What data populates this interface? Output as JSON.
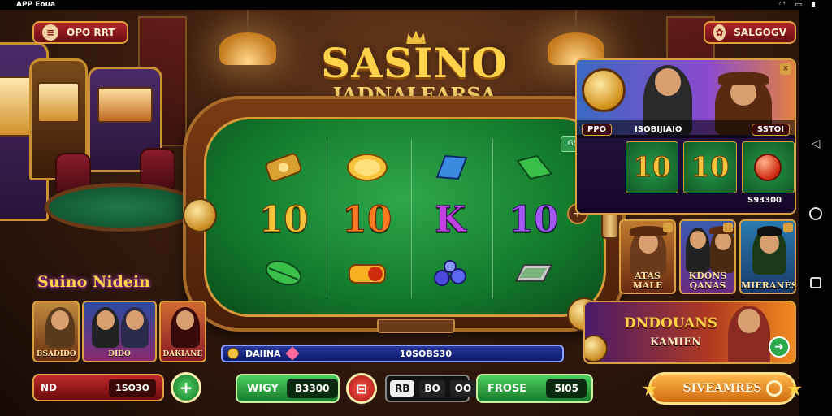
{
  "status_bar": {
    "app_name": "APP Eoua",
    "icons": [
      "wifi-icon",
      "battery-icon",
      "signal-icon"
    ]
  },
  "top_left_pill": {
    "label": "OPO RRT",
    "icon": "menu-icon"
  },
  "top_right_pill": {
    "label": "SALGOGV",
    "icon": "gift-icon"
  },
  "title": {
    "line1": "SASINO",
    "line2": "IADNALEARSA"
  },
  "game_table": {
    "badge": "G5",
    "reels": [
      [
        "cash-icon",
        "gold-coin-icon",
        "blue-card-icon",
        "green-card-icon"
      ],
      [
        "10",
        "10",
        "K",
        "10"
      ],
      [
        "leaf-icon",
        "red-bar-icon",
        "blue-gems-icon",
        "cash-stack-icon"
      ]
    ],
    "right_arrow": "+"
  },
  "right_panel": {
    "tag_left": "PPO",
    "tag_mid": "ISOBIJIAIO",
    "tag_right": "SSTOI",
    "values": [
      "10",
      "10"
    ],
    "total": "S93300"
  },
  "character_cards_right": [
    {
      "label": "ATAS MALE"
    },
    {
      "label": "KDONS QANAS"
    },
    {
      "label": "MIERANES"
    }
  ],
  "promo_banner": {
    "line1": "DNDOUANS",
    "line2": "KAMIEN"
  },
  "left_promo": {
    "title": "Suino Nidein",
    "cards": [
      {
        "label": "BSADIDO"
      },
      {
        "label": "DIDO"
      },
      {
        "label": "DAKIANE"
      }
    ]
  },
  "strip": {
    "label": "DAIINA",
    "amount": "10SOBS30"
  },
  "bottom_bar": {
    "bet_label": "ND",
    "bet_value": "1SO3O",
    "plus_label": "+",
    "win_label": "WIGY",
    "win_value": "B3300",
    "minus_label": "⊟",
    "mini_a": "RB",
    "mini_b": "BO",
    "mini_c": "OO",
    "froe_label": "FROSE",
    "froe_value": "5I05",
    "spin_label": "SIVEAMRES"
  },
  "colors": {
    "felt": "#1f8a3a",
    "gold": "#ffd24a",
    "wood": "#7a3a14",
    "accent_red": "#b0262a"
  }
}
